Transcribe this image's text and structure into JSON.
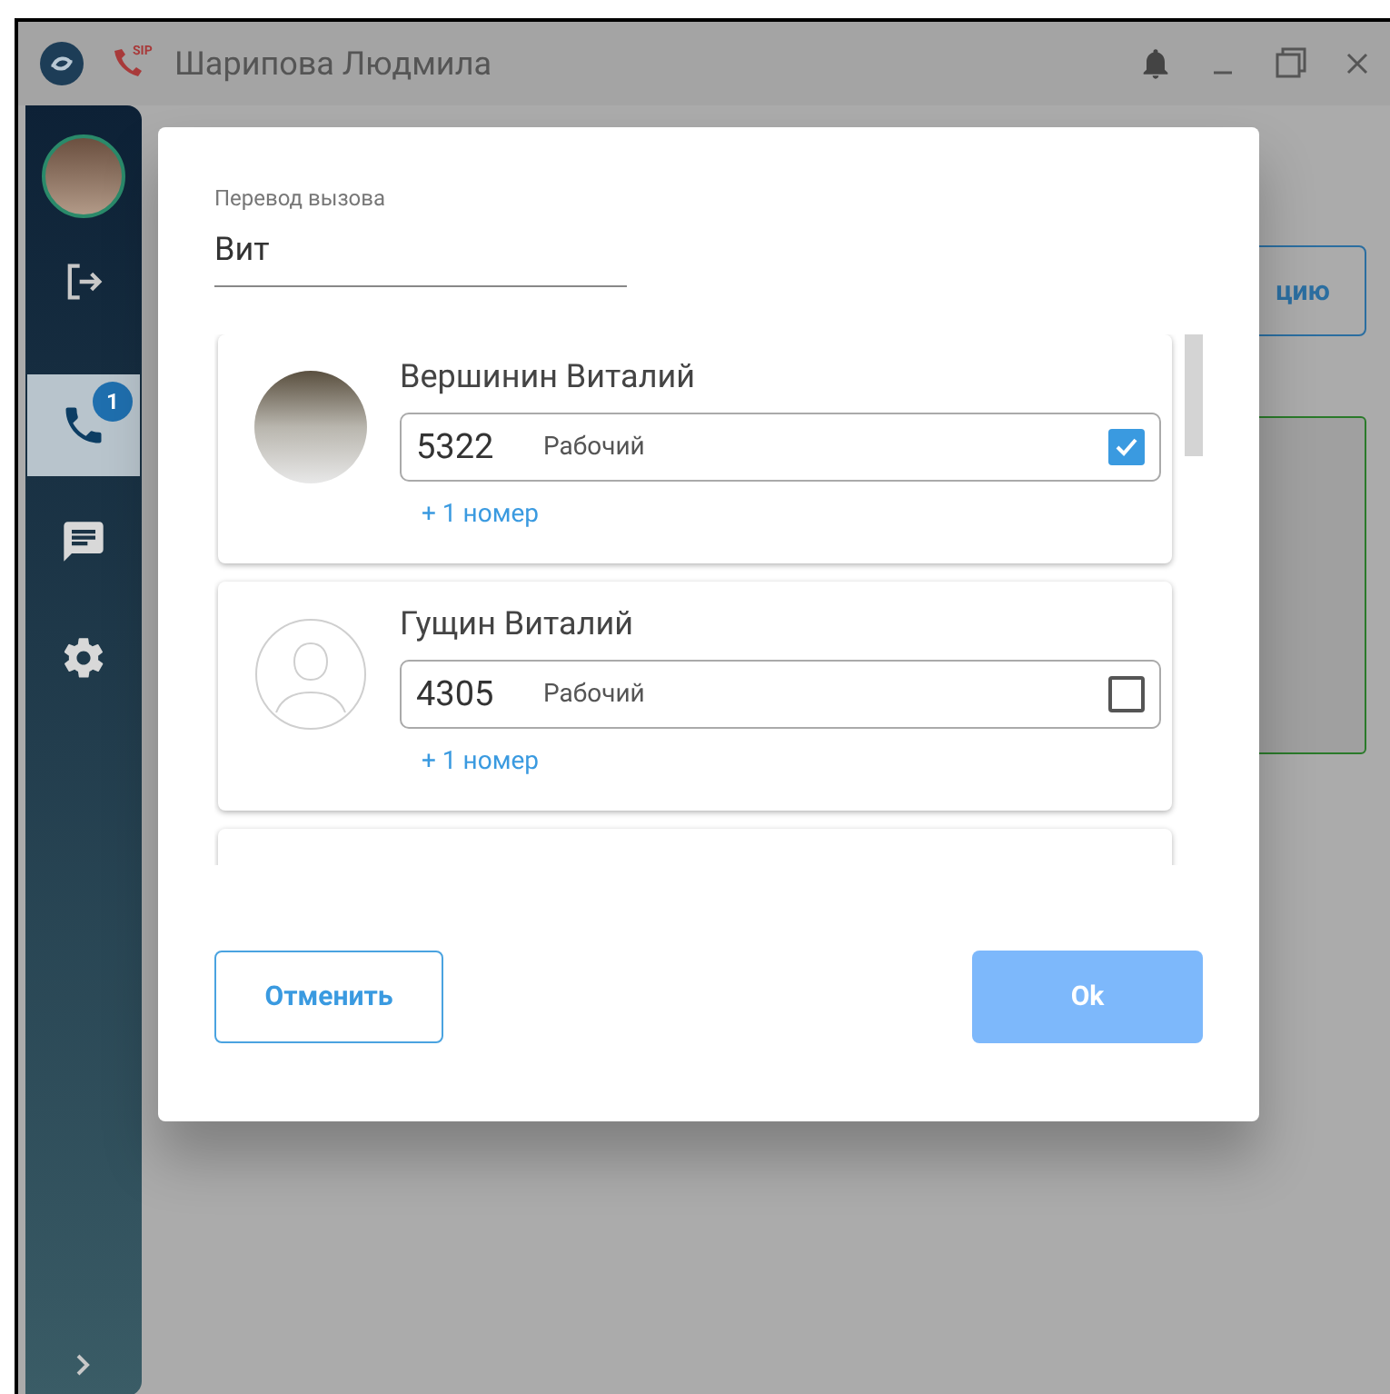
{
  "window": {
    "title": "Шарипова Людмила",
    "sip_label": "SIP"
  },
  "nav": [
    {
      "kind": "phone",
      "selected": true,
      "badge": "1"
    },
    {
      "kind": "chat",
      "selected": false
    },
    {
      "kind": "settings",
      "selected": false
    }
  ],
  "background": {
    "button_label": "цию"
  },
  "dialog": {
    "field": {
      "label": "Перевод вызова",
      "value": "Вит"
    },
    "contacts": [
      {
        "name": "Вершинин Виталий",
        "kind": "photo",
        "number": "5322",
        "number_type": "Рабочий",
        "checked": true,
        "more_link": "+ 1 номер"
      },
      {
        "name": "Гущин Виталий",
        "kind": "silhouette",
        "number": "4305",
        "number_type": "Рабочий",
        "checked": false,
        "more_link": "+ 1 номер"
      }
    ],
    "cancel_button": "Отменить",
    "ok_button": "Ok"
  }
}
